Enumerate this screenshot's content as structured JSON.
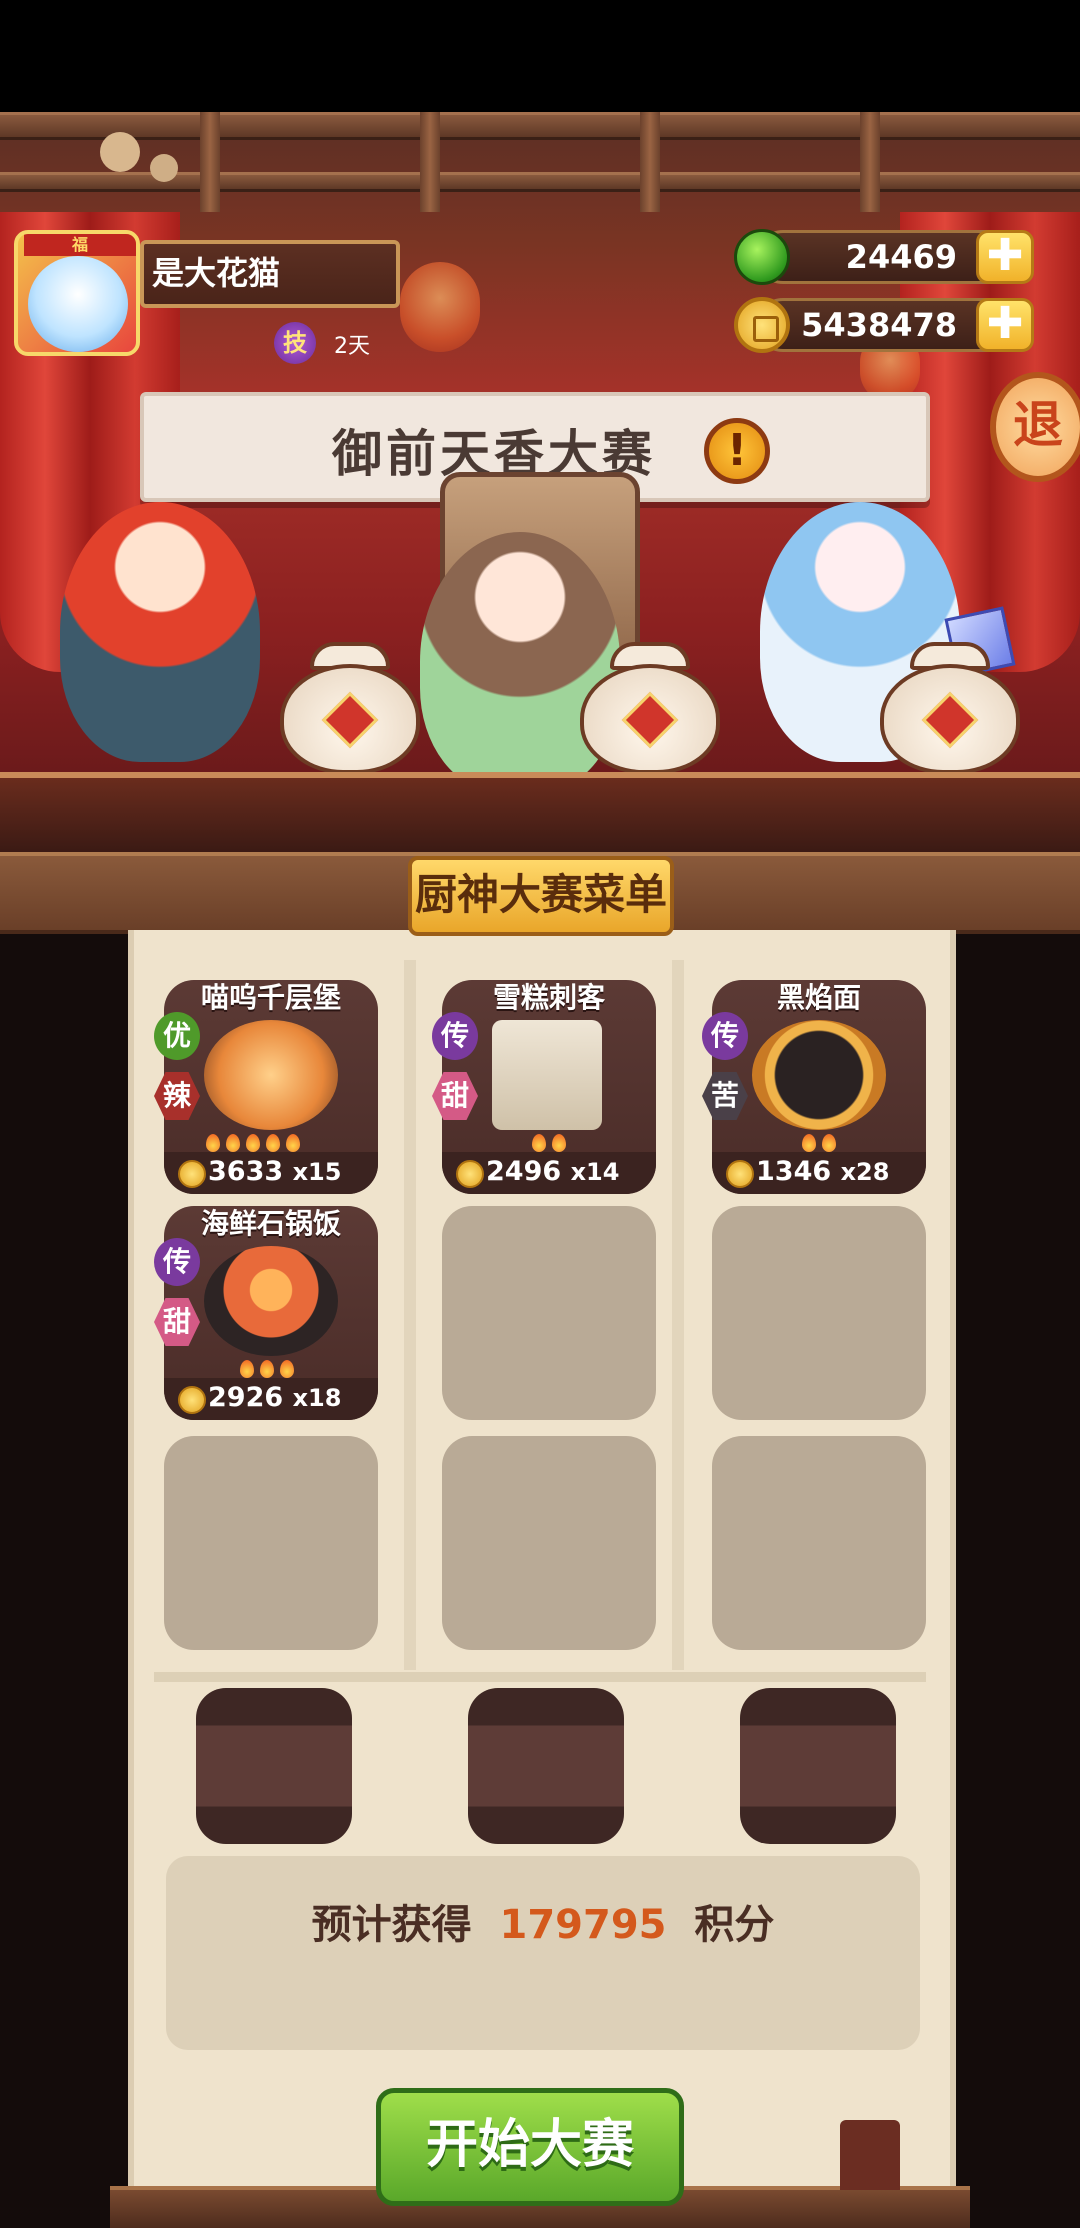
{
  "player": {
    "name": "是大花猫",
    "skill_badge": "技",
    "skill_duration": "2天",
    "avatar_tag": "福"
  },
  "currency": {
    "jade": "24469",
    "coins": "5438478",
    "plus_label": "✚"
  },
  "exit_label": "退",
  "banner": {
    "title": "御前天香大赛",
    "alert": "!"
  },
  "menu": {
    "title": "厨神大赛菜单",
    "dishes": [
      {
        "name": "喵呜千层堡",
        "rarity": "优",
        "flavor": "辣",
        "price": "3633",
        "qty": "x15",
        "fires": 5
      },
      {
        "name": "雪糕刺客",
        "rarity": "传",
        "flavor": "甜",
        "price": "2496",
        "qty": "x14",
        "fires": 2
      },
      {
        "name": "黑焰面",
        "rarity": "传",
        "flavor": "苦",
        "price": "1346",
        "qty": "x28",
        "fires": 2
      },
      {
        "name": "海鲜石锅饭",
        "rarity": "传",
        "flavor": "甜",
        "price": "2926",
        "qty": "x18",
        "fires": 3
      }
    ]
  },
  "estimate": {
    "prefix": "预计获得",
    "points": "179795",
    "suffix": "积分"
  },
  "start_button": "开始大赛",
  "colors": {
    "accent": "#d4591c",
    "button_green": "#5aa82a",
    "rarity_excellent": "#4f9a2a",
    "rarity_legend": "#7a3a9e",
    "flavor_spicy": "#a8302b",
    "flavor_sweet": "#d45a86",
    "flavor_bitter": "#4a4048"
  }
}
